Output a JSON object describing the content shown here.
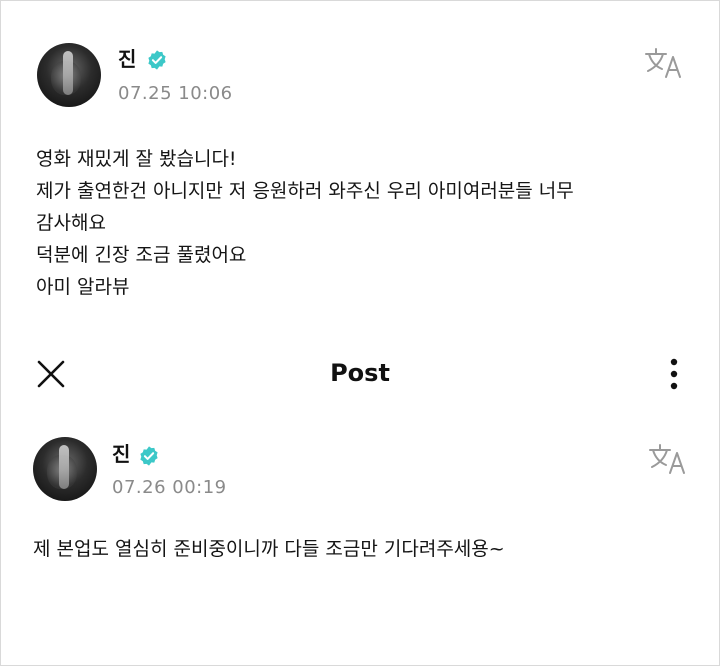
{
  "header": {
    "title": "Post"
  },
  "posts": [
    {
      "author": "진",
      "verified": true,
      "date": "07.25 10:06",
      "lines": [
        "영화 재밌게 잘 봤습니다!",
        "제가 출연한건 아니지만 저 응원하러 와주신 우리 아미여러분들 너무",
        "감사해요",
        "덕분에 긴장 조금 풀렸어요",
        "아미 알라뷰"
      ]
    },
    {
      "author": "진",
      "verified": true,
      "date": "07.26 00:19",
      "lines": [
        "제 본업도 열심히 준비중이니까 다들 조금만 기다려주세용~"
      ]
    }
  ],
  "icons": {
    "translate": "translate-icon",
    "verified": "verified-badge-icon",
    "close": "close-icon",
    "more": "more-vertical-icon"
  },
  "colors": {
    "verified": "#3cc8c8",
    "date": "#8a8a8a",
    "icon_gray": "#9a9a9a"
  }
}
